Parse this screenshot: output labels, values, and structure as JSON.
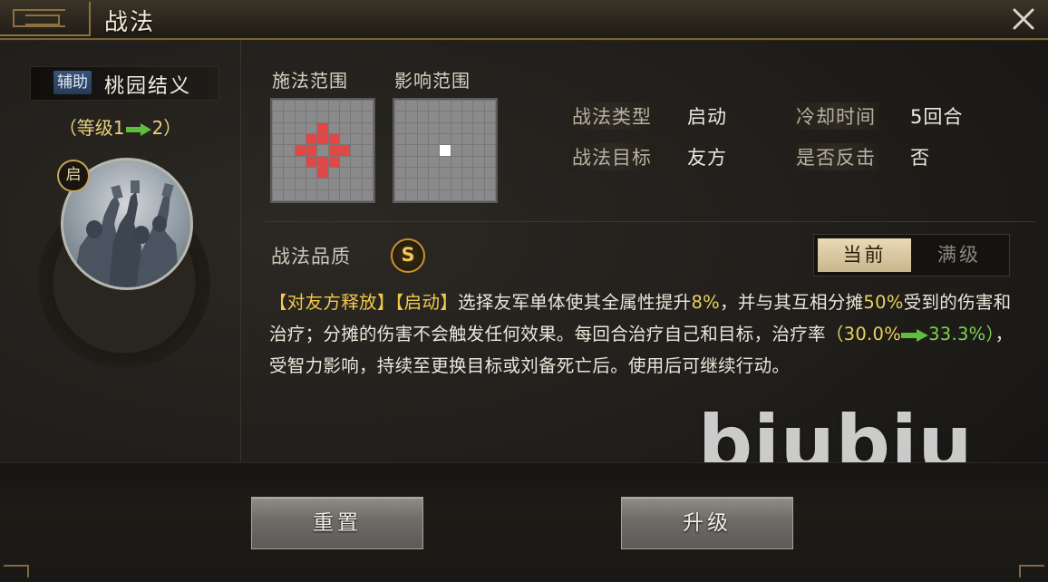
{
  "window": {
    "title": "战法",
    "close_icon": "close-icon"
  },
  "skill": {
    "tag": "辅助",
    "name": "桃园结义",
    "level_prefix": "（等级1",
    "level_suffix": "2）",
    "badge": "启"
  },
  "ranges": {
    "cast_label": "施法范围",
    "effect_label": "影响范围"
  },
  "info": {
    "type_label": "战法类型",
    "type_value": "启动",
    "cooldown_label": "冷却时间",
    "cooldown_value": "5回合",
    "target_label": "战法目标",
    "target_value": "友方",
    "counter_label": "是否反击",
    "counter_value": "否"
  },
  "quality": {
    "label": "战法品质",
    "value": "S"
  },
  "toggle": {
    "current": "当前",
    "max": "满级"
  },
  "description": {
    "tag1": "【对友方释放】",
    "tag2": "【启动】",
    "part1": "选择友军单体使其全属性提升",
    "num1": "8%",
    "part2": "，并与其互相分摊",
    "num2": "50%",
    "part3": "受到的伤害和治疗；分摊的伤害不会触发任何效果。每回合治疗自己和目标，治疗率",
    "num3": "（30.0%",
    "num4": "33.3%）",
    "part4": "，受智力影响，持续至更换目标或刘备死亡后。使用后可继续行动。"
  },
  "watermark": "biubiu",
  "buttons": {
    "reset": "重置",
    "upgrade": "升级"
  },
  "colors": {
    "accent_gold": "#c9a25b",
    "highlight_yellow": "#e8d15c",
    "highlight_green": "#7ed14d",
    "range_red": "#e04848"
  }
}
